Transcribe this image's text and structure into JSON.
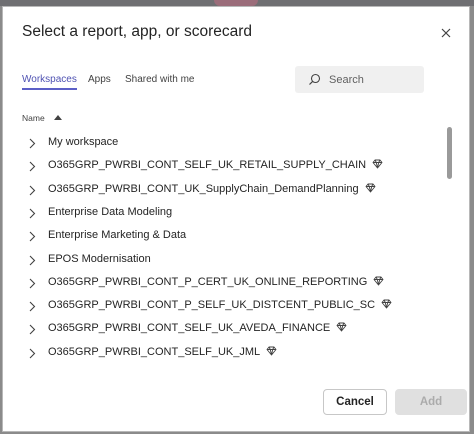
{
  "dialog": {
    "title": "Select a report, app, or scorecard",
    "close_icon": "close-icon"
  },
  "tabs": [
    {
      "label": "Workspaces",
      "active": true
    },
    {
      "label": "Apps",
      "active": false
    },
    {
      "label": "Shared with me",
      "active": false
    }
  ],
  "search": {
    "placeholder": "Search",
    "value": "",
    "icon": "search-icon"
  },
  "list": {
    "column_header": "Name",
    "sort": "ascending",
    "items": [
      {
        "label": "My workspace",
        "premium": false
      },
      {
        "label": "O365GRP_PWRBI_CONT_SELF_UK_RETAIL_SUPPLY_CHAIN",
        "premium": true
      },
      {
        "label": "O365GRP_PWRBI_CONT_UK_SupplyChain_DemandPlanning",
        "premium": true
      },
      {
        "label": "Enterprise Data Modeling",
        "premium": false
      },
      {
        "label": "Enterprise Marketing & Data",
        "premium": false
      },
      {
        "label": "EPOS Modernisation",
        "premium": false
      },
      {
        "label": "O365GRP_PWRBI_CONT_P_CERT_UK_ONLINE_REPORTING",
        "premium": true
      },
      {
        "label": "O365GRP_PWRBI_CONT_P_SELF_UK_DISTCENT_PUBLIC_SC",
        "premium": true
      },
      {
        "label": "O365GRP_PWRBI_CONT_SELF_UK_AVEDA_FINANCE",
        "premium": true
      },
      {
        "label": "O365GRP_PWRBI_CONT_SELF_UK_JML",
        "premium": true
      }
    ]
  },
  "buttons": {
    "cancel": "Cancel",
    "add": "Add",
    "add_disabled": true
  },
  "colors": {
    "accent": "#5b5fc7",
    "text": "#242424",
    "disabled_bg": "#e0e0e0"
  }
}
